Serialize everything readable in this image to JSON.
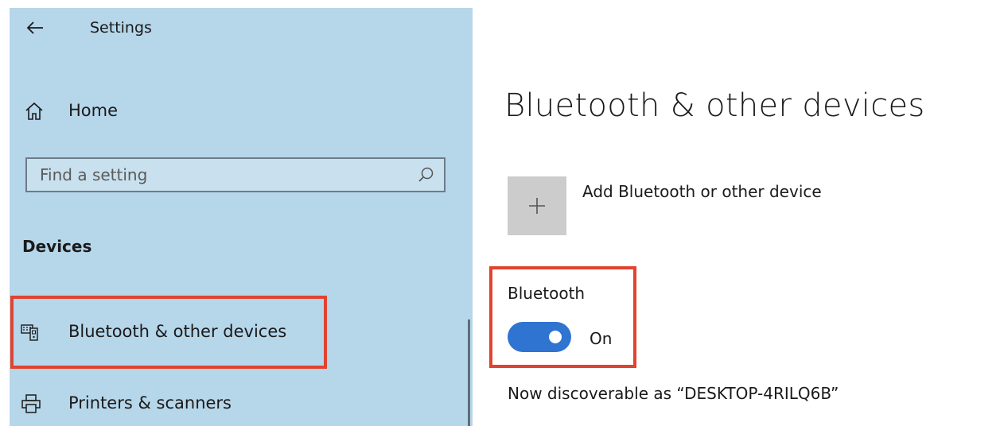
{
  "window": {
    "title": "Settings",
    "back_icon": "back-arrow-icon"
  },
  "sidebar": {
    "home_label": "Home",
    "home_icon": "home-icon",
    "search": {
      "placeholder": "Find a setting",
      "value": "",
      "icon": "search-icon"
    },
    "section_heading": "Devices",
    "items": [
      {
        "label": "Bluetooth & other devices",
        "icon": "bluetooth-devices-icon",
        "selected": true
      },
      {
        "label": "Printers & scanners",
        "icon": "printer-icon",
        "selected": false
      }
    ]
  },
  "main": {
    "page_title": "Bluetooth & other devices",
    "add_device": {
      "label": "Add Bluetooth or other device",
      "icon": "plus-icon"
    },
    "bluetooth": {
      "label": "Bluetooth",
      "toggle_state": "On",
      "is_on": true
    },
    "discoverable_text": "Now discoverable as “DESKTOP-4RILQ6B”"
  },
  "colors": {
    "sidebar_bg": "#b6d6ea",
    "accent": "#2f74d0",
    "highlight": "#e0432f",
    "tile_bg": "#cccccc"
  }
}
